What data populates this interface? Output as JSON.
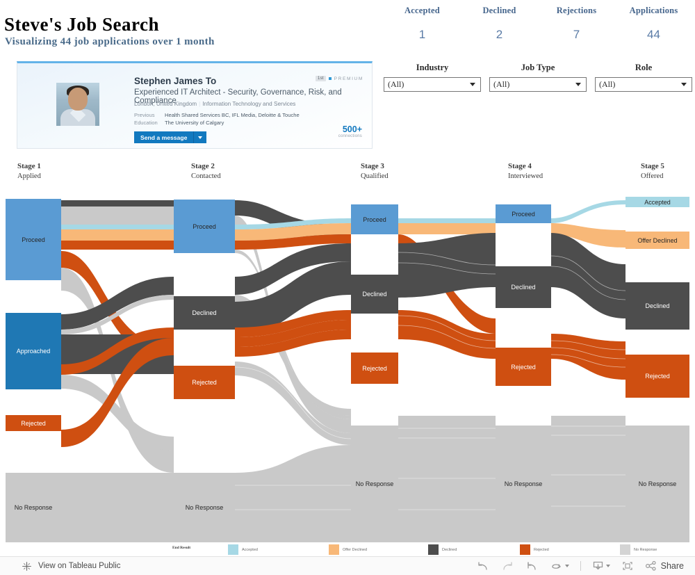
{
  "header": {
    "title": "Steve's Job Search",
    "subtitle": "Visualizing 44 job applications over 1 month"
  },
  "kpis": [
    {
      "label": "Accepted",
      "value": "1"
    },
    {
      "label": "Declined",
      "value": "2"
    },
    {
      "label": "Rejections",
      "value": "7"
    },
    {
      "label": "Applications",
      "value": "44"
    }
  ],
  "filters": [
    {
      "label": "Industry",
      "value": "(All)"
    },
    {
      "label": "Job Type",
      "value": "(All)"
    },
    {
      "label": "Role",
      "value": "(All)"
    }
  ],
  "profile": {
    "name": "Stephen James To",
    "headline": "Experienced IT Architect - Security, Governance, Risk, and Compliance",
    "location": "London, United Kingdom",
    "industry": "Information Technology and Services",
    "previous_label": "Previous",
    "previous_value": "Health Shared Services BC, IFL Media, Deloitte & Touche",
    "education_label": "Education",
    "education_value": "The University of Calgary",
    "message_button": "Send a message",
    "premium_badge": "1st",
    "premium_text": "PREMIUM",
    "connections_count": "500+",
    "connections_label": "connections"
  },
  "chart_data": {
    "type": "sankey",
    "title": "Steve's Job Search",
    "subtitle": "Visualizing 44 job applications over 1 month",
    "total_applications": 44,
    "stages": [
      {
        "number": "Stage 1",
        "name": "Applied"
      },
      {
        "number": "Stage 2",
        "name": "Contacted"
      },
      {
        "number": "Stage 3",
        "name": "Qualified"
      },
      {
        "number": "Stage 4",
        "name": "Interviewed"
      },
      {
        "number": "Stage 5",
        "name": "Offered"
      }
    ],
    "colors": {
      "proceed": "#5a9bd3",
      "approached": "#1f78b4",
      "accepted": "#a6d8e5",
      "offer_declined": "#f8b878",
      "declined": "#4d4d4d",
      "rejected": "#cf4f11",
      "no_response": "#c9c9c9"
    },
    "nodes": [
      {
        "stage": 1,
        "label": "Proceed",
        "color": "proceed",
        "value": 16
      },
      {
        "stage": 1,
        "label": "Approached",
        "color": "approached",
        "value": 12
      },
      {
        "stage": 1,
        "label": "Rejected",
        "color": "rejected",
        "value": 2
      },
      {
        "stage": 1,
        "label": "No Response",
        "color": "no_response",
        "value": 14
      },
      {
        "stage": 2,
        "label": "Proceed",
        "color": "proceed",
        "value": 12
      },
      {
        "stage": 2,
        "label": "Declined",
        "color": "declined",
        "value": 5
      },
      {
        "stage": 2,
        "label": "Rejected",
        "color": "rejected",
        "value": 6
      },
      {
        "stage": 2,
        "label": "No Response",
        "color": "no_response",
        "value": 21
      },
      {
        "stage": 3,
        "label": "Proceed",
        "color": "proceed",
        "value": 5
      },
      {
        "stage": 3,
        "label": "Declined",
        "color": "declined",
        "value": 6
      },
      {
        "stage": 3,
        "label": "Rejected",
        "color": "rejected",
        "value": 5
      },
      {
        "stage": 3,
        "label": "No Response",
        "color": "no_response",
        "value": 21
      },
      {
        "stage": 4,
        "label": "Proceed",
        "color": "proceed",
        "value": 3
      },
      {
        "stage": 4,
        "label": "Declined",
        "color": "declined",
        "value": 5
      },
      {
        "stage": 4,
        "label": "Rejected",
        "color": "rejected",
        "value": 5
      },
      {
        "stage": 4,
        "label": "No Response",
        "color": "no_response",
        "value": 21
      },
      {
        "stage": 5,
        "label": "Accepted",
        "color": "accepted",
        "value": 1
      },
      {
        "stage": 5,
        "label": "Offer Declined",
        "color": "offer_declined",
        "value": 2
      },
      {
        "stage": 5,
        "label": "Declined",
        "color": "declined",
        "value": 5
      },
      {
        "stage": 5,
        "label": "Rejected",
        "color": "rejected",
        "value": 5
      },
      {
        "stage": 5,
        "label": "No Response",
        "color": "no_response",
        "value": 21
      }
    ]
  },
  "legend": {
    "title": "End Result",
    "items": [
      {
        "label": "Accepted",
        "color": "#a6d8e5"
      },
      {
        "label": "Offer Declined",
        "color": "#f8b878"
      },
      {
        "label": "Declined",
        "color": "#4d4d4d"
      },
      {
        "label": "Rejected",
        "color": "#cf4f11"
      },
      {
        "label": "No Response",
        "color": "#c9c9c9"
      }
    ]
  },
  "toolbar": {
    "view_label": "View on Tableau Public",
    "share_label": "Share",
    "icons": [
      "undo-icon",
      "redo-icon",
      "revert-icon",
      "refresh-icon",
      "download-icon",
      "fullscreen-icon",
      "share-icon"
    ]
  }
}
